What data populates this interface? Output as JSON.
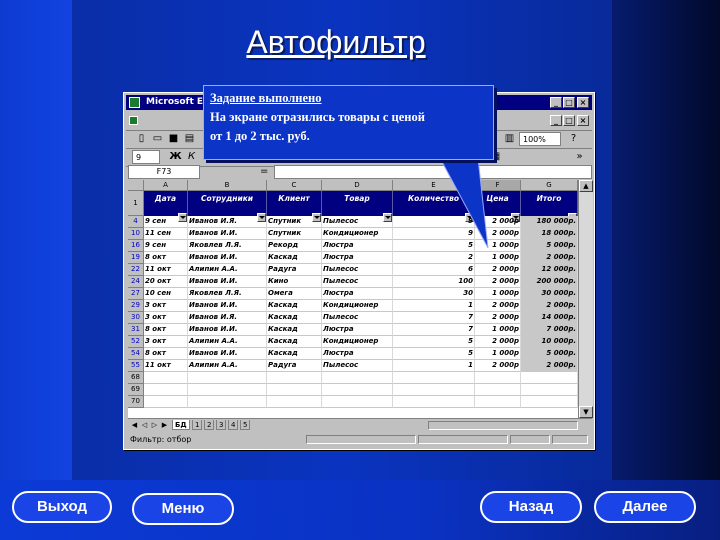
{
  "slide": {
    "title": "Автофильтр",
    "colors": {
      "background": "#0a32c0",
      "callout": "#0c35c8",
      "header_fill": "#000080"
    }
  },
  "excel": {
    "window_title": "Microsoft Exce",
    "name_box": "F73",
    "formula_prefix": "=",
    "zoom": "100%",
    "font_size": "9",
    "format_buttons": [
      "Ж",
      "К"
    ],
    "column_letters": [
      "A",
      "B",
      "C",
      "D",
      "E",
      "F",
      "G"
    ],
    "headers": [
      "Дата",
      "Сотрудники",
      "Клиент",
      "Товар",
      "Количество",
      "Цена",
      "Итого"
    ],
    "rows": [
      {
        "n": "4",
        "date": "9 сен",
        "emp": "Иванов И.Я.",
        "client": "Спутник",
        "item": "Пылесос",
        "qty": "9",
        "price": "2 000р",
        "total": "180 000р."
      },
      {
        "n": "10",
        "date": "11 сен",
        "emp": "Иванов И.И.",
        "client": "Спутник",
        "item": "Кондиционер",
        "qty": "9",
        "price": "2 000р",
        "total": "18 000р."
      },
      {
        "n": "16",
        "date": "9 сен",
        "emp": "Яковлев Л.Я.",
        "client": "Рекорд",
        "item": "Люстра",
        "qty": "5",
        "price": "1 000р",
        "total": "5 000р."
      },
      {
        "n": "19",
        "date": "8 окт",
        "emp": "Иванов И.И.",
        "client": "Каскад",
        "item": "Люстра",
        "qty": "2",
        "price": "1 000р",
        "total": "2 000р."
      },
      {
        "n": "22",
        "date": "11 окт",
        "emp": "Алипин А.А.",
        "client": "Радуга",
        "item": "Пылесос",
        "qty": "6",
        "price": "2 000р",
        "total": "12 000р."
      },
      {
        "n": "24",
        "date": "20 окт",
        "emp": "Иванов И.И.",
        "client": "Кино",
        "item": "Пылесос",
        "qty": "100",
        "price": "2 000р",
        "total": "200 000р."
      },
      {
        "n": "27",
        "date": "10 сен",
        "emp": "Яковлев Л.Я.",
        "client": "Омега",
        "item": "Люстра",
        "qty": "30",
        "price": "1 000р",
        "total": "30 000р."
      },
      {
        "n": "29",
        "date": "3 окт",
        "emp": "Иванов И.И.",
        "client": "Каскад",
        "item": "Кондиционер",
        "qty": "1",
        "price": "2 000р",
        "total": "2 000р."
      },
      {
        "n": "30",
        "date": "3 окт",
        "emp": "Иванов И.Я.",
        "client": "Каскад",
        "item": "Пылесос",
        "qty": "7",
        "price": "2 000р",
        "total": "14 000р."
      },
      {
        "n": "31",
        "date": "8 окт",
        "emp": "Иванов И.И.",
        "client": "Каскад",
        "item": "Люстра",
        "qty": "7",
        "price": "1 000р",
        "total": "7 000р."
      },
      {
        "n": "52",
        "date": "3 окт",
        "emp": "Алипин А.А.",
        "client": "Каскад",
        "item": "Кондиционер",
        "qty": "5",
        "price": "2 000р",
        "total": "10 000р."
      },
      {
        "n": "54",
        "date": "8 окт",
        "emp": "Иванов И.И.",
        "client": "Каскад",
        "item": "Люстра",
        "qty": "5",
        "price": "1 000р",
        "total": "5 000р."
      },
      {
        "n": "55",
        "date": "11 окт",
        "emp": "Алипин А.А.",
        "client": "Радуга",
        "item": "Пылесос",
        "qty": "1",
        "price": "2 000р",
        "total": "2 000р."
      }
    ],
    "empty_rows": [
      "68",
      "69",
      "70"
    ],
    "sheet_tabs": [
      "БД",
      "1",
      "2",
      "3",
      "4",
      "5"
    ],
    "status": "Фильтр: отбор"
  },
  "callout": {
    "heading": "Задание выполнено",
    "line1": "На экране отразились товары с ценой",
    "line2": "от 1  до 2 тыс. руб."
  },
  "nav": {
    "exit": "Выход",
    "menu": "Меню",
    "back": "Назад",
    "next": "Далее"
  }
}
